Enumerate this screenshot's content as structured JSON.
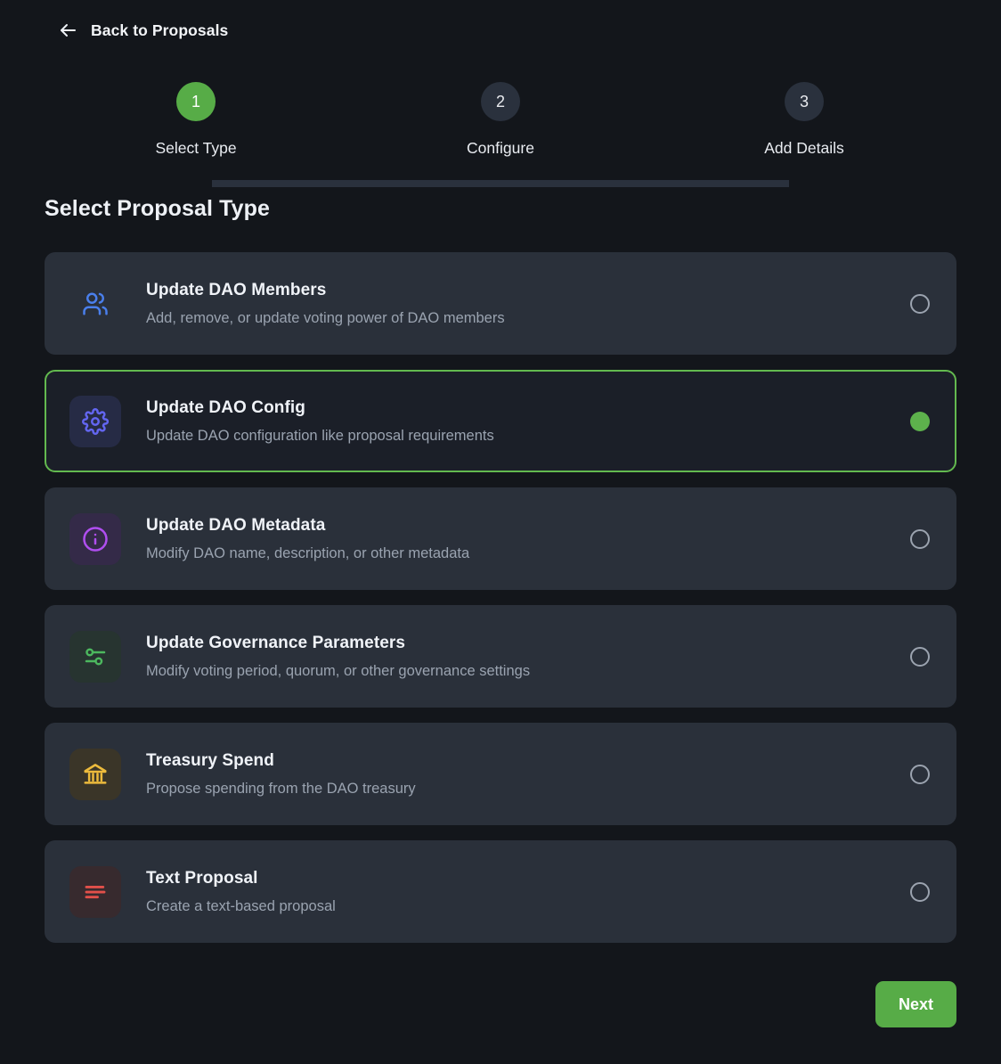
{
  "back": {
    "label": "Back to Proposals",
    "icon": "arrow-left-icon"
  },
  "stepper": {
    "steps": [
      {
        "number": "1",
        "label": "Select Type",
        "state": "active"
      },
      {
        "number": "2",
        "label": "Configure",
        "state": "inactive"
      },
      {
        "number": "3",
        "label": "Add Details",
        "state": "inactive"
      }
    ]
  },
  "section": {
    "title": "Select Proposal Type"
  },
  "proposal_types": [
    {
      "title": "Update DAO Members",
      "description": "Add, remove, or update voting power of DAO members",
      "icon": "users-icon",
      "icon_color": "#4a7fec",
      "icon_bg": "#243046",
      "selected": false
    },
    {
      "title": "Update DAO Config",
      "description": "Update DAO configuration like proposal requirements",
      "icon": "gear-icon",
      "icon_color": "#6366f1",
      "icon_bg": "#262b45",
      "selected": true
    },
    {
      "title": "Update DAO Metadata",
      "description": "Modify DAO name, description, or other metadata",
      "icon": "info-circle-icon",
      "icon_color": "#b04ef0",
      "icon_bg": "#342a48",
      "selected": false
    },
    {
      "title": "Update Governance Parameters",
      "description": "Modify voting period, quorum, or other governance settings",
      "icon": "sliders-icon",
      "icon_color": "#4cb85e",
      "icon_bg": "#273430",
      "selected": false
    },
    {
      "title": "Treasury Spend",
      "description": "Propose spending from the DAO treasury",
      "icon": "bank-icon",
      "icon_color": "#edbb3c",
      "icon_bg": "#3a3528",
      "selected": false
    },
    {
      "title": "Text Proposal",
      "description": "Create a text-based proposal",
      "icon": "text-lines-icon",
      "icon_color": "#e2504a",
      "icon_bg": "#372a2e",
      "selected": false
    }
  ],
  "footer": {
    "next_label": "Next"
  },
  "colors": {
    "page_background": "#13161b",
    "card_background": "#2a303a",
    "card_selected_background": "#1b1f28",
    "accent_green": "#57ac47",
    "selected_border": "#63b94f",
    "track": "#2a313d",
    "step_inactive": "#2a313d",
    "title_text": "#f0f3f8",
    "muted_text": "#9aa3b0"
  }
}
